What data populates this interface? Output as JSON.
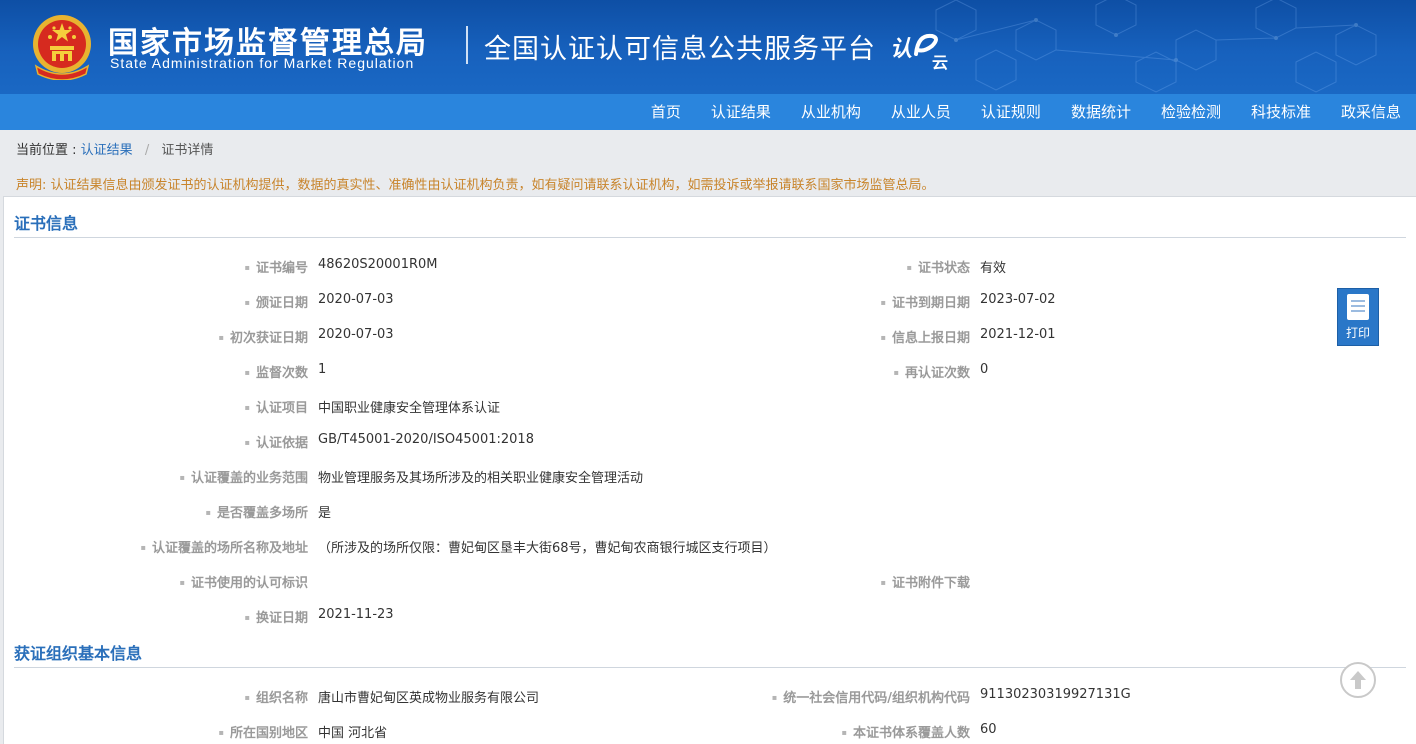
{
  "header": {
    "org_cn": "国家市场监督管理总局",
    "org_en": "State Administration  for  Market Regulation",
    "platform": "全国认证认可信息公共服务平台",
    "logo_text": "认e云"
  },
  "nav": {
    "items": [
      "首页",
      "认证结果",
      "从业机构",
      "从业人员",
      "认证规则",
      "数据统计",
      "检验检测",
      "科技标准",
      "政采信息"
    ]
  },
  "breadcrumb": {
    "prefix": "当前位置 :",
    "link": "认证结果",
    "sep": "/",
    "current": "证书详情"
  },
  "notice": "声明: 认证结果信息由颁发证书的认证机构提供，数据的真实性、准确性由认证机构负责，如有疑问请联系认证机构，如需投诉或举报请联系国家市场监管总局。",
  "cert_section": {
    "title": "证书信息",
    "fields": {
      "cert_no": {
        "label": "证书编号",
        "value": "48620S20001R0M"
      },
      "status": {
        "label": "证书状态",
        "value": "有效"
      },
      "issue_date": {
        "label": "颁证日期",
        "value": "2020-07-03"
      },
      "expire_date": {
        "label": "证书到期日期",
        "value": "2023-07-02"
      },
      "first_date": {
        "label": "初次获证日期",
        "value": "2020-07-03"
      },
      "report_date": {
        "label": "信息上报日期",
        "value": "2021-12-01"
      },
      "supervision": {
        "label": "监督次数",
        "value": "1"
      },
      "recert": {
        "label": "再认证次数",
        "value": "0"
      },
      "project": {
        "label": "认证项目",
        "value": "中国职业健康安全管理体系认证"
      },
      "basis": {
        "label": "认证依据",
        "value": "GB/T45001-2020/ISO45001:2018"
      },
      "scope": {
        "label": "认证覆盖的业务范围",
        "value": "物业管理服务及其场所涉及的相关职业健康安全管理活动"
      },
      "multi_site": {
        "label": "是否覆盖多场所",
        "value": "是"
      },
      "sites": {
        "label": "认证覆盖的场所名称及地址",
        "value": "（所涉及的场所仅限：曹妃甸区垦丰大街68号，曹妃甸农商银行城区支行项目）"
      },
      "accredit_mark": {
        "label": "证书使用的认可标识",
        "value": ""
      },
      "attachment": {
        "label": "证书附件下载",
        "value": ""
      },
      "renew_date": {
        "label": "换证日期",
        "value": "2021-11-23"
      }
    }
  },
  "org_section": {
    "title": "获证组织基本信息",
    "fields": {
      "org_name": {
        "label": "组织名称",
        "value": "唐山市曹妃甸区英成物业服务有限公司"
      },
      "credit_code": {
        "label": "统一社会信用代码/组织机构代码",
        "value": "91130230319927131G"
      },
      "region": {
        "label": "所在国别地区",
        "value": "中国 河北省"
      },
      "headcount": {
        "label": "本证书体系覆盖人数",
        "value": "60"
      }
    }
  },
  "print_label": "打印"
}
